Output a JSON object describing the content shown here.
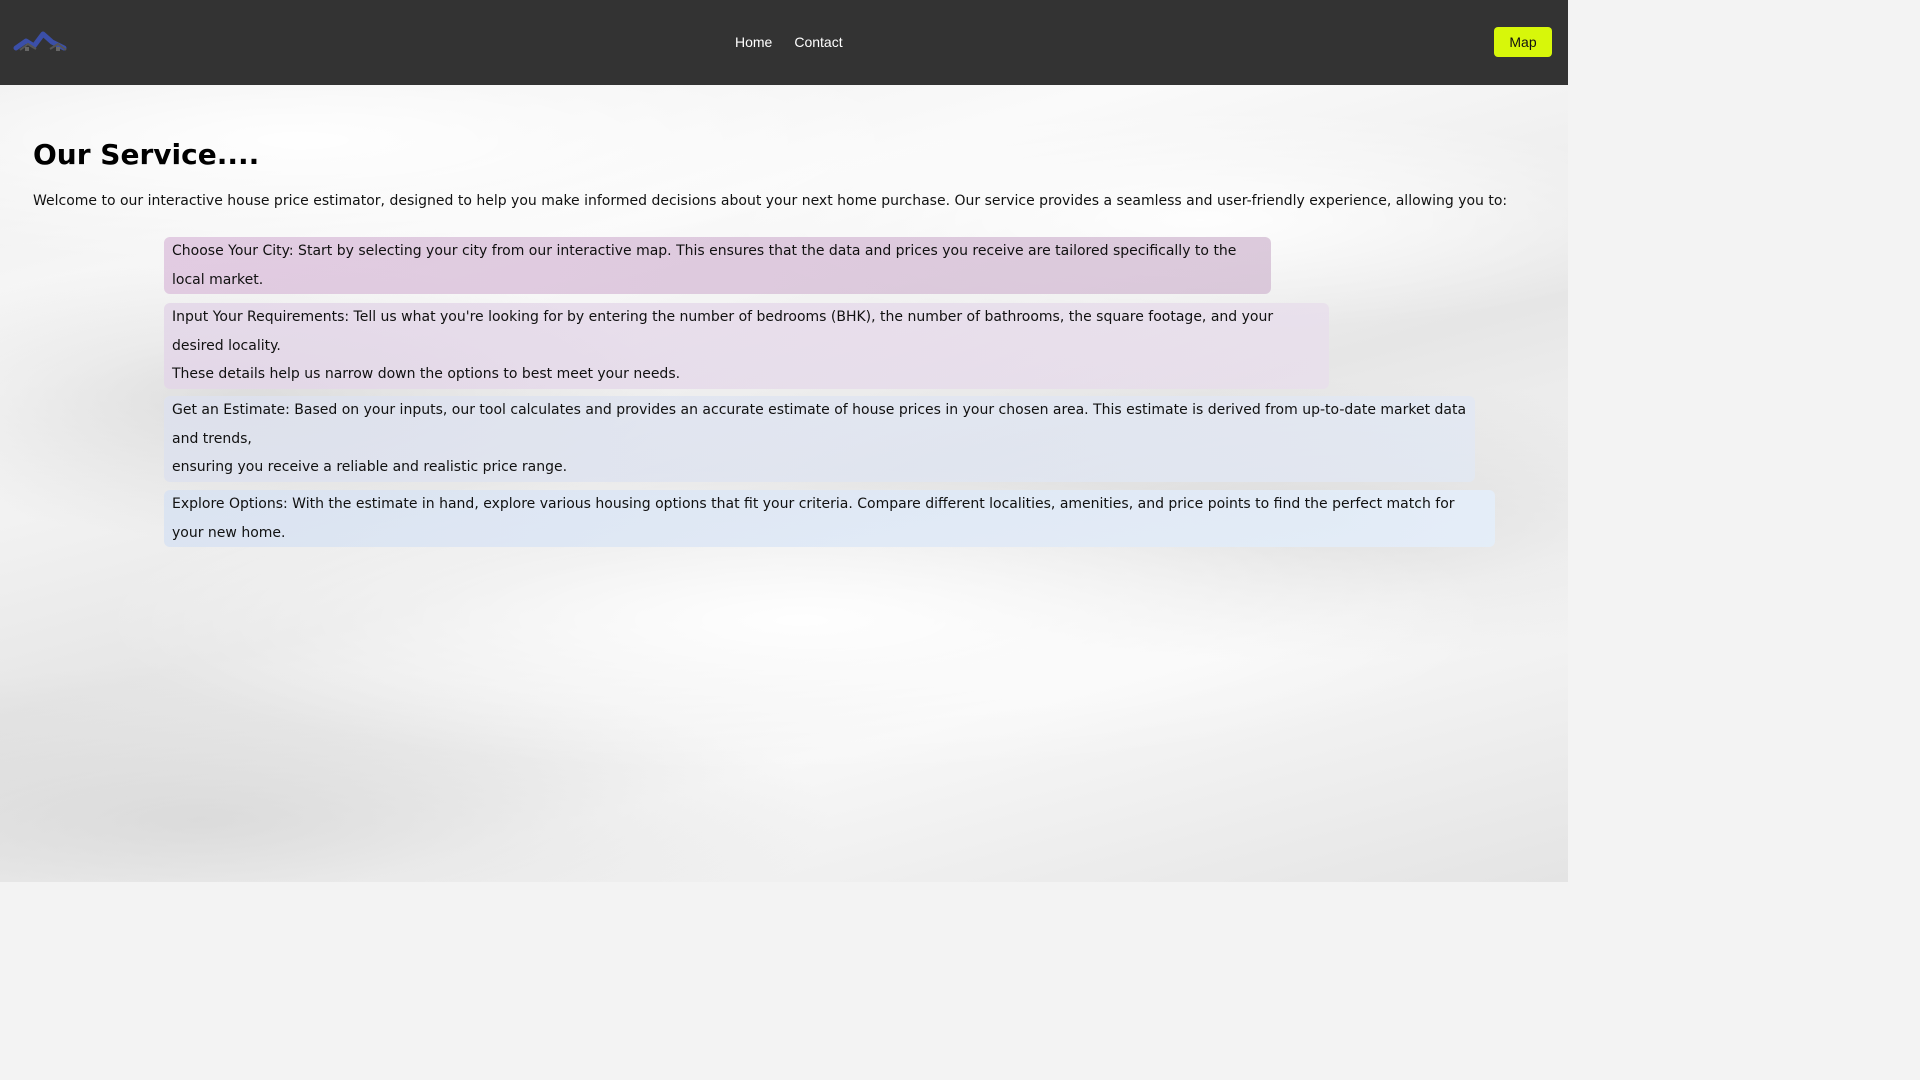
{
  "nav": {
    "logo_icon": "house-logo-icon",
    "links": [
      {
        "label": "Home"
      },
      {
        "label": "Contact"
      }
    ],
    "map_button": "Map",
    "colors": {
      "navbar": "#333333",
      "map_button": "#d7f70a"
    }
  },
  "main": {
    "title": "Our Service....",
    "intro": "Welcome to our interactive house price estimator, designed to help you make informed decisions about your next home purchase. Our service provides a seamless and user-friendly experience, allowing you to:",
    "steps": [
      {
        "text": "Choose Your City: Start by selecting your city from our interactive map. This ensures that the data and prices you receive are tailored specifically to the local market."
      },
      {
        "text_line1": "Input Your Requirements: Tell us what you're looking for by entering the number of bedrooms (BHK), the number of bathrooms, the square footage, and your desired locality.",
        "text_line2": "These details help us narrow down the options to best meet your needs."
      },
      {
        "text_line1": "Get an Estimate: Based on your inputs, our tool calculates and provides an accurate estimate of house prices in your chosen area. This estimate is derived from up-to-date market data and trends,",
        "text_line2": "ensuring you receive a reliable and realistic price range."
      },
      {
        "text": "Explore Options: With the estimate in hand, explore various housing options that fit your criteria. Compare different localities, amenities, and price points to find the perfect match for your new home."
      }
    ]
  }
}
